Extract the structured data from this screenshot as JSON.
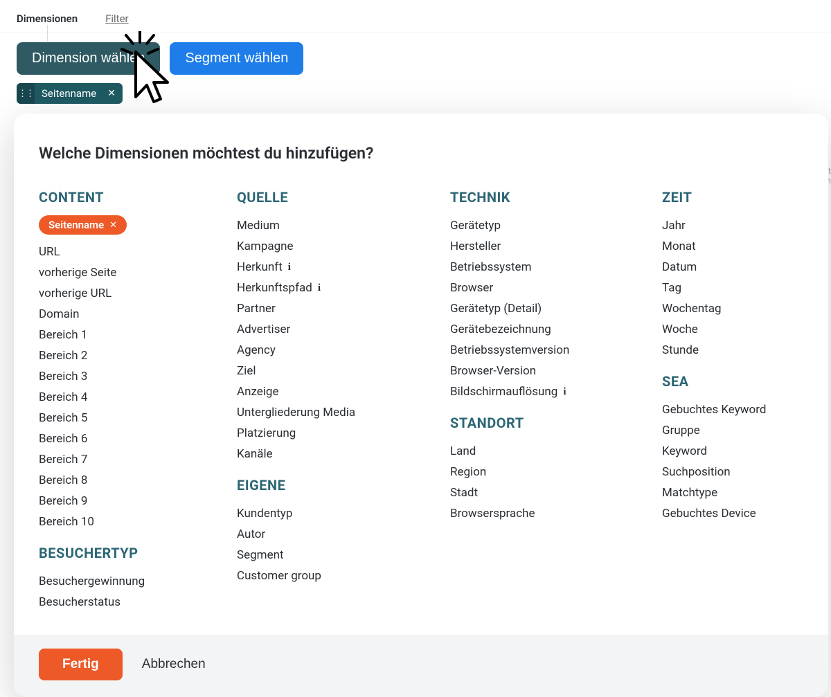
{
  "tabs": {
    "active": "Dimensionen",
    "inactive": "Filter"
  },
  "toolbar": {
    "dimension_btn": "Dimension wählen",
    "segment_btn": "Segment wählen"
  },
  "chip": {
    "label": "Seitenname"
  },
  "modal": {
    "title": "Welche Dimensionen möchtest du hinzufügen?",
    "footer": {
      "done": "Fertig",
      "cancel": "Abbrechen"
    },
    "selected_pill": "Seitenname",
    "groups": {
      "content": {
        "title": "CONTENT",
        "items": [
          "URL",
          "vorherige Seite",
          "vorherige URL",
          "Domain",
          "Bereich 1",
          "Bereich 2",
          "Bereich 3",
          "Bereich 4",
          "Bereich 5",
          "Bereich 6",
          "Bereich 7",
          "Bereich 8",
          "Bereich 9",
          "Bereich 10"
        ]
      },
      "besuchertyp": {
        "title": "BESUCHERTYP",
        "items": [
          "Besuchergewinnung",
          "Besucherstatus"
        ]
      },
      "quelle": {
        "title": "QUELLE",
        "items": [
          "Medium",
          "Kampagne",
          "Herkunft",
          "Herkunftspfad",
          "Partner",
          "Advertiser",
          "Agency",
          "Ziel",
          "Anzeige",
          "Untergliederung Media",
          "Platzierung",
          "Kanäle"
        ],
        "info_idx": [
          2,
          3
        ]
      },
      "eigene": {
        "title": "EIGENE",
        "items": [
          "Kundentyp",
          "Autor",
          "Segment",
          "Customer group"
        ]
      },
      "technik": {
        "title": "TECHNIK",
        "items": [
          "Gerätetyp",
          "Hersteller",
          "Betriebssystem",
          "Browser",
          "Gerätetyp (Detail)",
          "Gerätebezeichnung",
          "Betriebssystemversion",
          "Browser-Version",
          "Bildschirmauflösung"
        ],
        "info_idx": [
          8
        ]
      },
      "standort": {
        "title": "STANDORT",
        "items": [
          "Land",
          "Region",
          "Stadt",
          "Browsersprache"
        ]
      },
      "zeit": {
        "title": "ZEIT",
        "items": [
          "Jahr",
          "Monat",
          "Datum",
          "Tag",
          "Wochentag",
          "Woche",
          "Stunde"
        ]
      },
      "sea": {
        "title": "SEA",
        "items": [
          "Gebuchtes Keyword",
          "Gruppe",
          "Keyword",
          "Suchposition",
          "Matchtype",
          "Gebuchtes Device"
        ]
      }
    }
  },
  "edge_hints": [
    "it",
    "n"
  ]
}
